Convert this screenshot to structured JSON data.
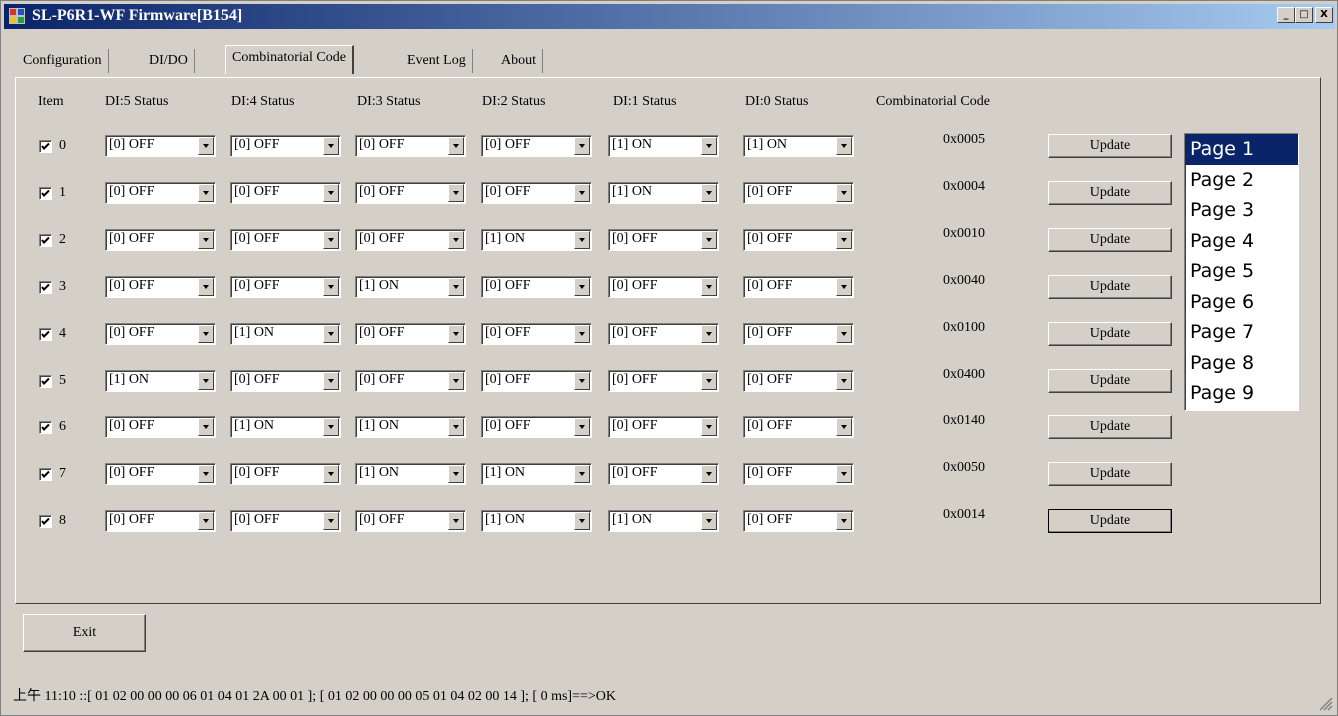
{
  "window": {
    "title": "SL-P6R1-WF Firmware[B154]",
    "controls": {
      "minimize": "_",
      "maximize": "□",
      "close": "X"
    }
  },
  "tabs": [
    {
      "label": "Configuration",
      "active": false
    },
    {
      "label": "DI/DO",
      "active": false
    },
    {
      "label": "Combinatorial Code",
      "active": true
    },
    {
      "label": "Event Log",
      "active": false
    },
    {
      "label": "About",
      "active": false
    }
  ],
  "headers": {
    "item": "Item",
    "di5": "DI:5 Status",
    "di4": "DI:4 Status",
    "di3": "DI:3 Status",
    "di2": "DI:2 Status",
    "di1": "DI:1 Status",
    "di0": "DI:0 Status",
    "code": "Combinatorial Code"
  },
  "rows": [
    {
      "item": "0",
      "checked": true,
      "di": [
        "[0] OFF",
        "[0] OFF",
        "[0] OFF",
        "[0] OFF",
        "[1] ON",
        "[1] ON"
      ],
      "code": "0x0005",
      "update": "Update"
    },
    {
      "item": "1",
      "checked": true,
      "di": [
        "[0] OFF",
        "[0] OFF",
        "[0] OFF",
        "[0] OFF",
        "[1] ON",
        "[0] OFF"
      ],
      "code": "0x0004",
      "update": "Update"
    },
    {
      "item": "2",
      "checked": true,
      "di": [
        "[0] OFF",
        "[0] OFF",
        "[0] OFF",
        "[1] ON",
        "[0] OFF",
        "[0] OFF"
      ],
      "code": "0x0010",
      "update": "Update"
    },
    {
      "item": "3",
      "checked": true,
      "di": [
        "[0] OFF",
        "[0] OFF",
        "[1] ON",
        "[0] OFF",
        "[0] OFF",
        "[0] OFF"
      ],
      "code": "0x0040",
      "update": "Update"
    },
    {
      "item": "4",
      "checked": true,
      "di": [
        "[0] OFF",
        "[1] ON",
        "[0] OFF",
        "[0] OFF",
        "[0] OFF",
        "[0] OFF"
      ],
      "code": "0x0100",
      "update": "Update"
    },
    {
      "item": "5",
      "checked": true,
      "di": [
        "[1] ON",
        "[0] OFF",
        "[0] OFF",
        "[0] OFF",
        "[0] OFF",
        "[0] OFF"
      ],
      "code": "0x0400",
      "update": "Update"
    },
    {
      "item": "6",
      "checked": true,
      "di": [
        "[0] OFF",
        "[1] ON",
        "[1] ON",
        "[0] OFF",
        "[0] OFF",
        "[0] OFF"
      ],
      "code": "0x0140",
      "update": "Update"
    },
    {
      "item": "7",
      "checked": true,
      "di": [
        "[0] OFF",
        "[0] OFF",
        "[1] ON",
        "[1] ON",
        "[0] OFF",
        "[0] OFF"
      ],
      "code": "0x0050",
      "update": "Update"
    },
    {
      "item": "8",
      "checked": true,
      "di": [
        "[0] OFF",
        "[0] OFF",
        "[0] OFF",
        "[1] ON",
        "[1] ON",
        "[0] OFF"
      ],
      "code": "0x0014",
      "update": "Update"
    }
  ],
  "pages": {
    "items": [
      "Page 1",
      "Page 2",
      "Page 3",
      "Page 4",
      "Page 5",
      "Page 6",
      "Page 7",
      "Page 8",
      "Page 9"
    ],
    "selected_index": 0
  },
  "exit_label": "Exit",
  "status_text": "上午 11:10 ::[ 01 02 00 00 00 06 01 04 01 2A 00 01 ]; [ 01 02 00 00 00 05 01 04 02 00 14 ]; [ 0 ms]==>OK",
  "colors": {
    "title_start": "#0a246a",
    "title_end": "#a6caf0",
    "selection": "#0a246a",
    "face": "#d4d0c8"
  }
}
